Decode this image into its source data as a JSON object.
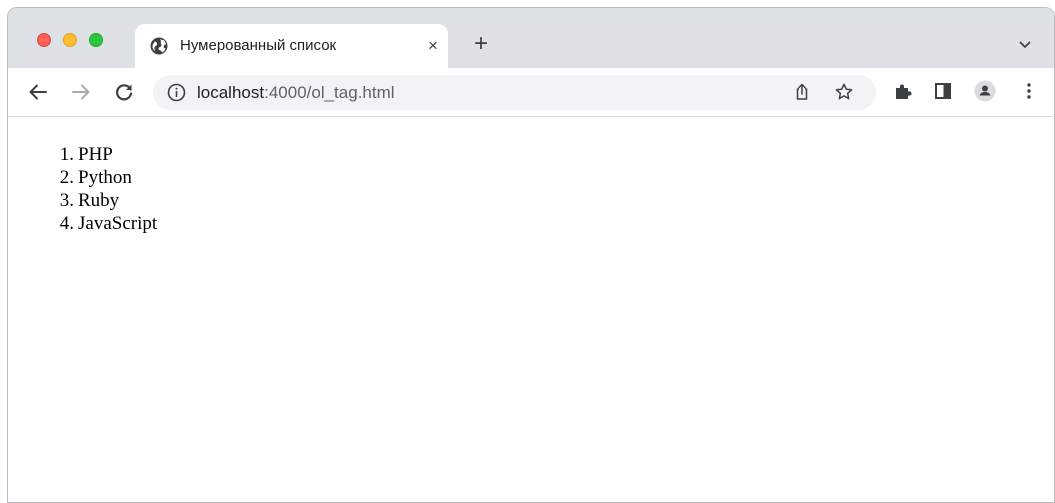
{
  "tab": {
    "title": "Нумерованный список",
    "close_label": "×",
    "new_tab_label": "+"
  },
  "toolbar": {
    "url_host": "localhost",
    "url_path": ":4000/ol_tag.html"
  },
  "icons": {
    "favicon": "globe-icon",
    "back": "arrow-left-icon",
    "forward": "arrow-right-icon",
    "reload": "reload-icon",
    "site_info": "info-icon",
    "share": "share-icon",
    "bookmark": "star-icon",
    "extensions": "puzzle-icon",
    "side_panel": "side-panel-icon",
    "profile": "profile-icon",
    "menu": "kebab-menu-icon",
    "tab_list": "chevron-down-icon"
  },
  "colors": {
    "close": "#fe5f57",
    "minimize": "#febc2e",
    "zoom": "#28c840",
    "tabstrip": "#dee1e6",
    "omnibox": "#f1f3f4"
  },
  "page": {
    "list": [
      {
        "number": "1.",
        "text": "PHP"
      },
      {
        "number": "2.",
        "text": "Python"
      },
      {
        "number": "3.",
        "text": "Ruby"
      },
      {
        "number": "4.",
        "text": "JavaScript"
      }
    ]
  }
}
